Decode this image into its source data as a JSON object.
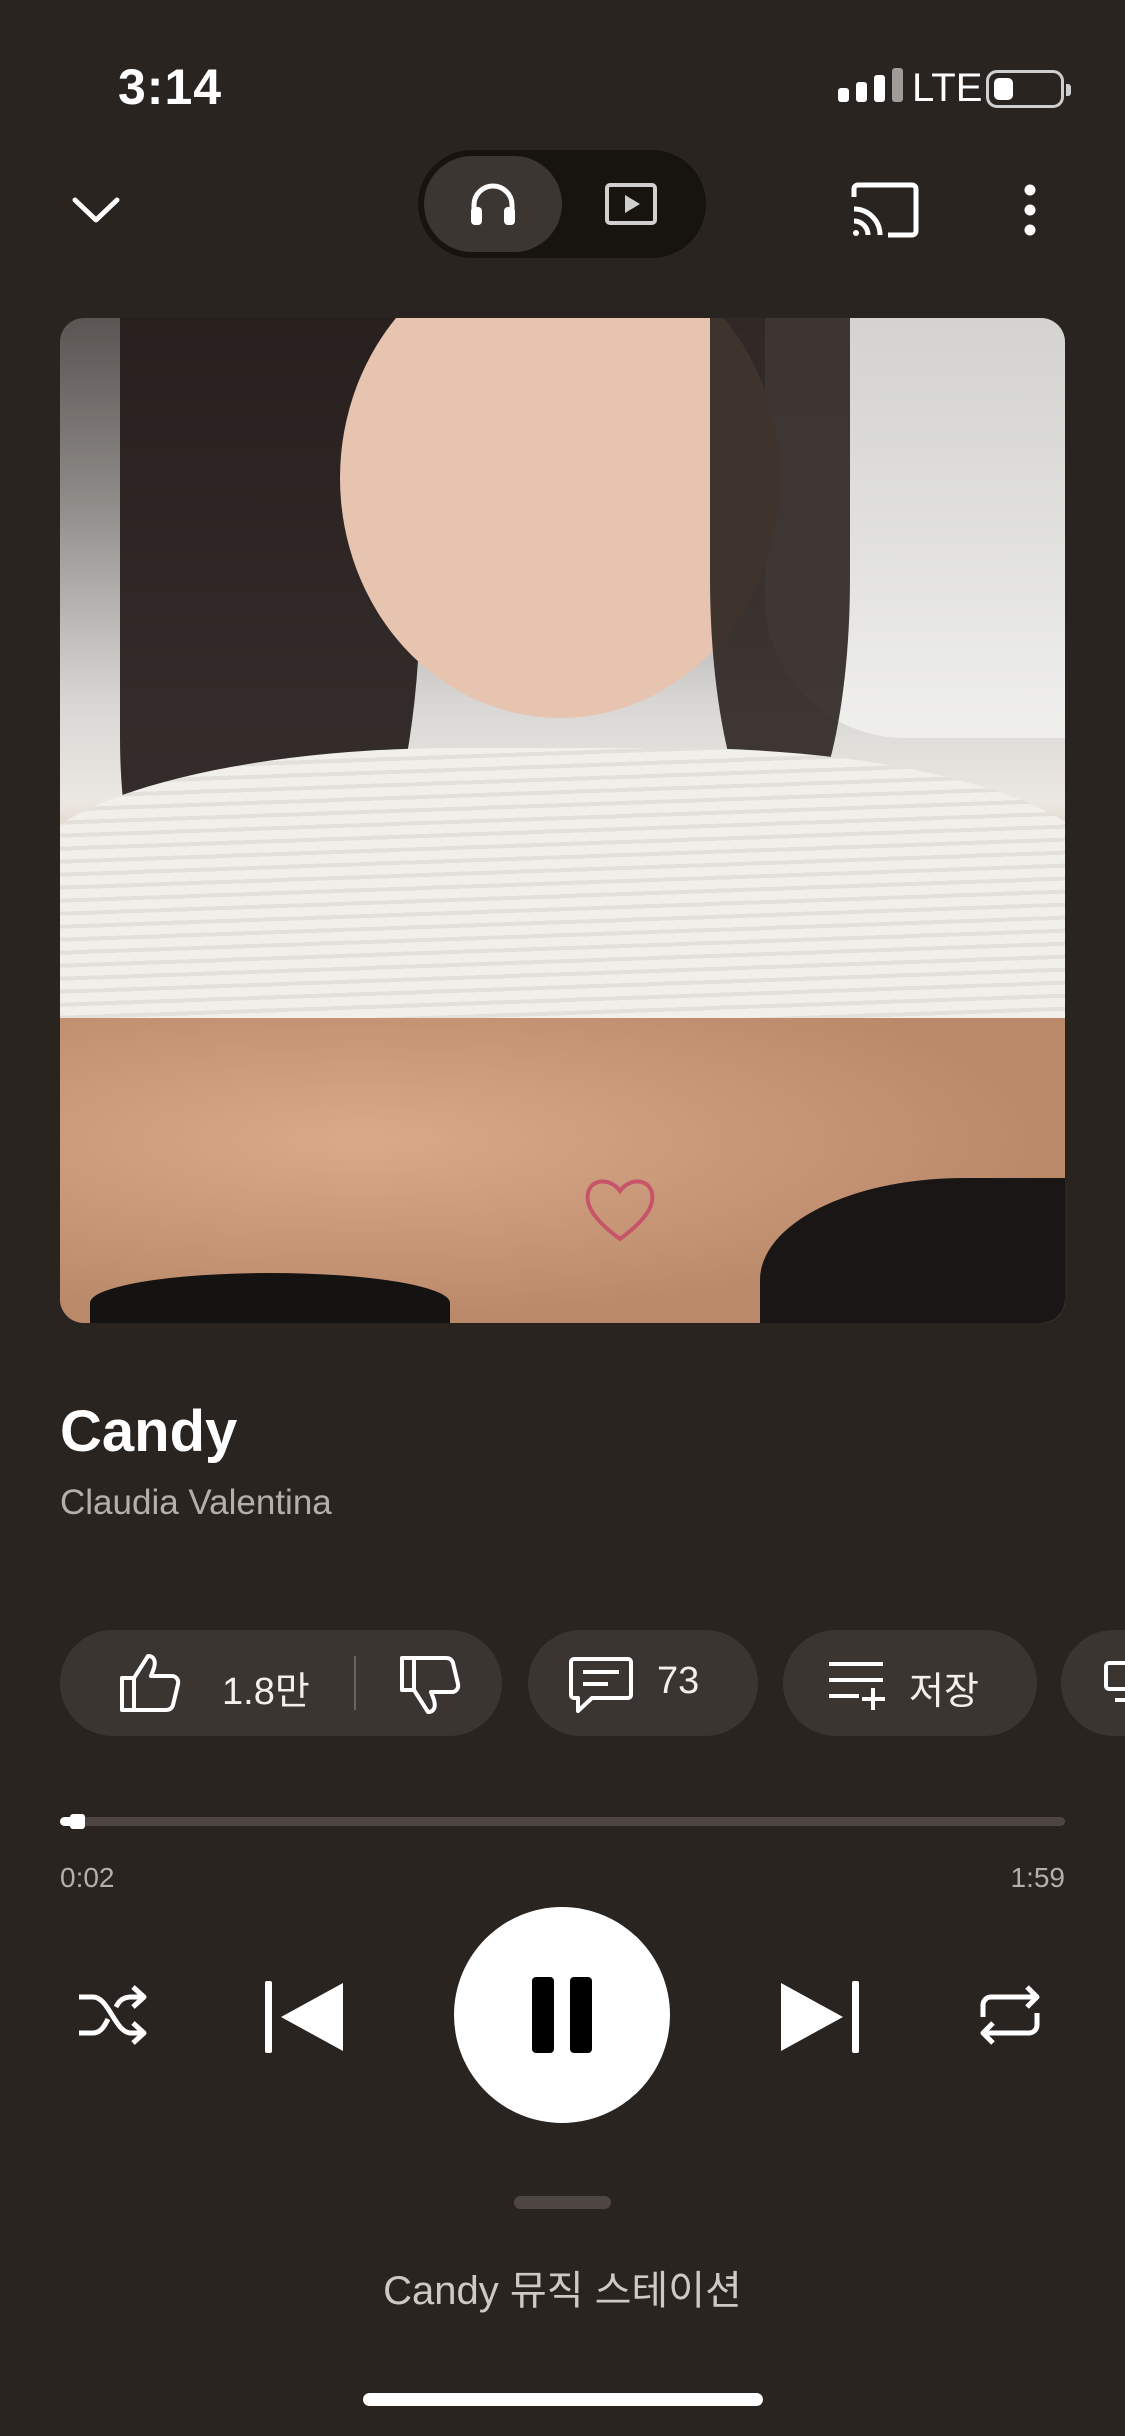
{
  "status_bar": {
    "time": "3:14",
    "network": "LTE",
    "battery_level": 0.3
  },
  "top_bar": {
    "collapse_icon": "chevron-down-icon",
    "toggle": {
      "options": [
        "headphones-icon",
        "video-icon"
      ],
      "selected": "headphones-icon"
    },
    "cast_icon": "cast-icon",
    "more_icon": "more-vertical-icon"
  },
  "song": {
    "title": "Candy",
    "artist": "Claudia Valentina"
  },
  "actions": {
    "like_count": "1.8만",
    "comment_count": "73",
    "save_label": "저장"
  },
  "playback": {
    "current_time": "0:02",
    "total_time": "1:59",
    "progress_fraction": 0.017
  },
  "up_next": {
    "label": "Candy 뮤직 스테이션"
  },
  "colors": {
    "background": "#2a2421",
    "pill": "#3b3532",
    "accent": "#ffffff"
  }
}
